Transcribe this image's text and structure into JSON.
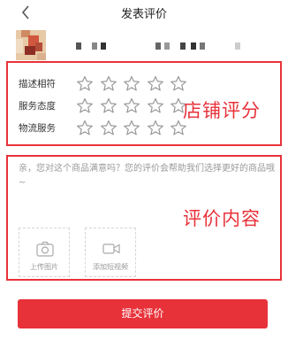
{
  "header": {
    "title": "发表评价",
    "back_icon": "chevron-left-icon"
  },
  "rating_section": {
    "annotation": "店铺评分",
    "items": [
      {
        "label": "描述相符",
        "stars_selected": 0,
        "stars_total": 5
      },
      {
        "label": "服务态度",
        "stars_selected": 0,
        "stars_total": 5
      },
      {
        "label": "物流服务",
        "stars_selected": 0,
        "stars_total": 5
      }
    ]
  },
  "review_section": {
    "annotation": "评价内容",
    "placeholder": "亲，您对这个商品满意吗？您的评价会帮助我们选择更好的商品哦~",
    "upload_photo": {
      "label": "上传图片",
      "icon": "camera-icon"
    },
    "upload_video": {
      "label": "添加短视频",
      "icon": "video-camera-icon"
    }
  },
  "submit_label": "提交评价",
  "colors": {
    "accent": "#e8323a",
    "star_outline": "#999999",
    "hint_text": "#999999"
  }
}
